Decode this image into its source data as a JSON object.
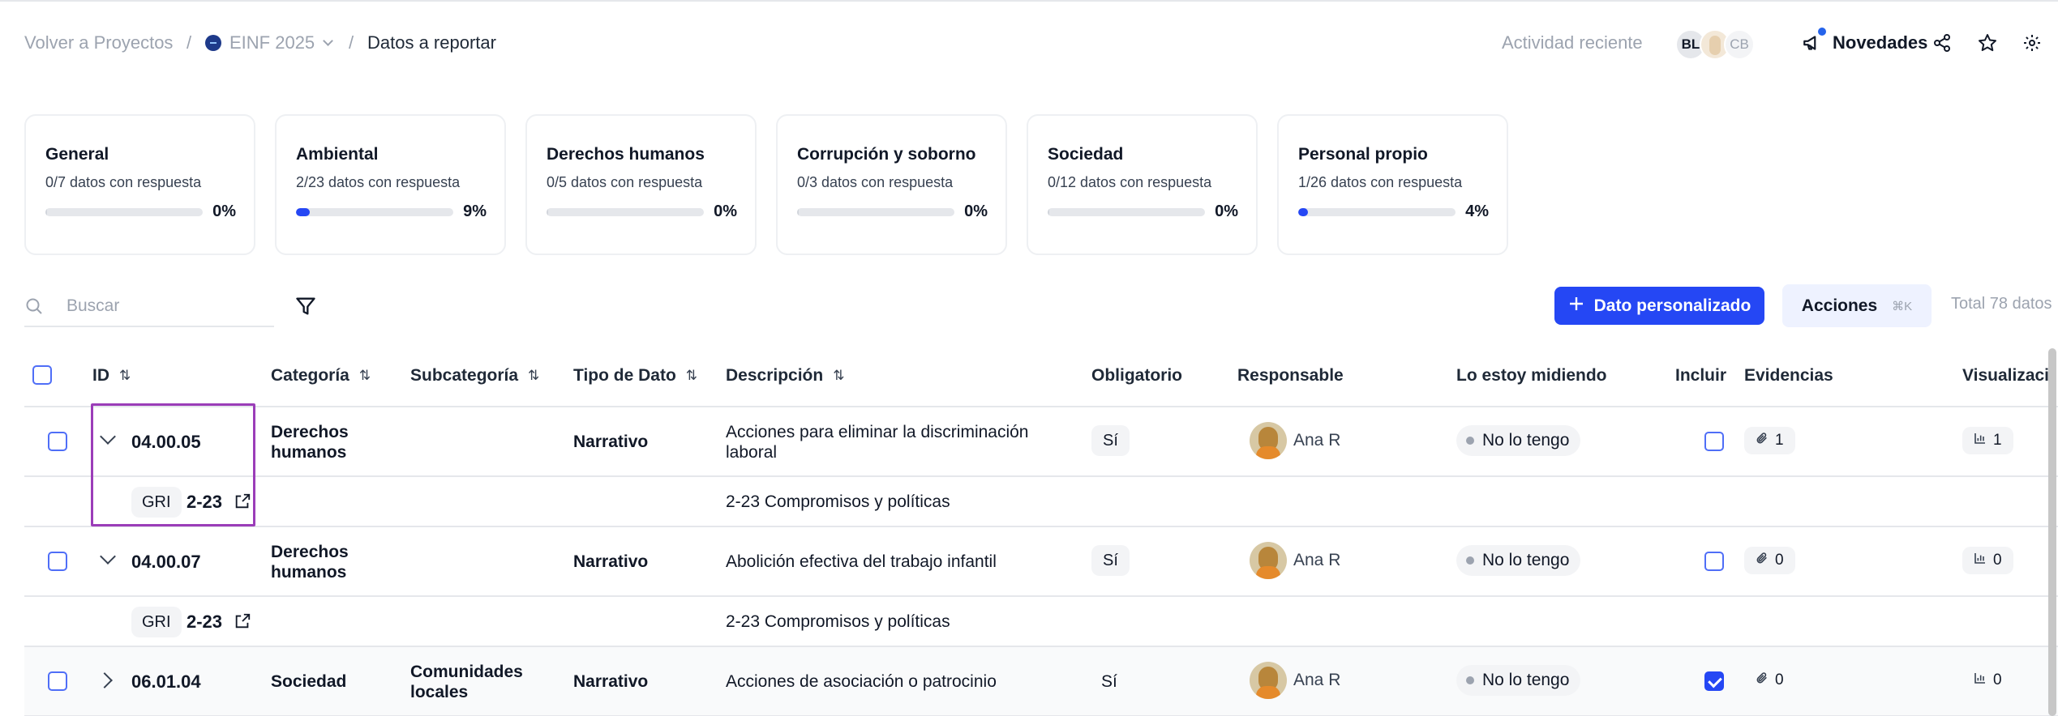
{
  "breadcrumb": {
    "back": "Volver a Proyectos",
    "separator": "/",
    "project": "EINF 2025",
    "current": "Datos a reportar"
  },
  "header": {
    "activity": "Actividad reciente",
    "avatar_1": "BL",
    "avatar_3": "CB",
    "news": "Novedades"
  },
  "cards": [
    {
      "title": "General",
      "sub": "0/7 datos con respuesta",
      "pct": "0%",
      "progress": 0.0
    },
    {
      "title": "Ambiental",
      "sub": "2/23 datos con respuesta",
      "pct": "9%",
      "progress": 0.09
    },
    {
      "title": "Derechos humanos",
      "sub": "0/5 datos con respuesta",
      "pct": "0%",
      "progress": 0.0
    },
    {
      "title": "Corrupción y soborno",
      "sub": "0/3 datos con respuesta",
      "pct": "0%",
      "progress": 0.0
    },
    {
      "title": "Sociedad",
      "sub": "0/12 datos con respuesta",
      "pct": "0%",
      "progress": 0.0
    },
    {
      "title": "Personal propio",
      "sub": "1/26 datos con respuesta",
      "pct": "4%",
      "progress": 0.04
    }
  ],
  "toolbar": {
    "search_placeholder": "Buscar",
    "search_value": "",
    "add_button": "Dato personalizado",
    "actions_button": "Acciones",
    "actions_shortcut": "⌘K",
    "total": "Total 78 datos"
  },
  "columns": {
    "id": "ID",
    "category": "Categoría",
    "subcategory": "Subcategoría",
    "type": "Tipo de Dato",
    "description": "Descripción",
    "mandatory": "Obligatorio",
    "owner": "Responsable",
    "measuring": "Lo estoy midiendo",
    "include": "Incluir",
    "evidence": "Evidencias",
    "views": "Visualizaci"
  },
  "rows": [
    {
      "id": "04.00.05",
      "category": "Derechos humanos",
      "subcategory": "",
      "type": "Narrativo",
      "description": "Acciones para eliminar la discriminación laboral",
      "mandatory": "Sí",
      "owner": "Ana R",
      "measuring": "No lo tengo",
      "include": false,
      "evidence": "1",
      "views": "1",
      "expanded": true,
      "sub": {
        "standard": "GRI",
        "code": "2-23",
        "description": "2-23 Compromisos y políticas"
      }
    },
    {
      "id": "04.00.07",
      "category": "Derechos humanos",
      "subcategory": "",
      "type": "Narrativo",
      "description": "Abolición efectiva del trabajo infantil",
      "mandatory": "Sí",
      "owner": "Ana R",
      "measuring": "No lo tengo",
      "include": false,
      "evidence": "0",
      "views": "0",
      "expanded": true,
      "sub": {
        "standard": "GRI",
        "code": "2-23",
        "description": "2-23 Compromisos y políticas"
      }
    },
    {
      "id": "06.01.04",
      "category": "Sociedad",
      "subcategory": "Comunidades locales",
      "type": "Narrativo",
      "description": "Acciones de asociación o patrocinio",
      "mandatory": "Sí",
      "owner": "Ana R",
      "measuring": "No lo tengo",
      "include": true,
      "evidence": "0",
      "views": "0",
      "expanded": false
    }
  ],
  "colors": {
    "accent": "#2547f4",
    "highlight": "#9b3db8",
    "muted_text": "#9ca3af"
  }
}
